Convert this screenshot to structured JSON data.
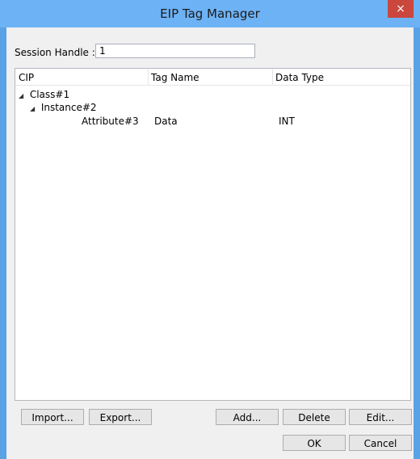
{
  "window": {
    "title": "EIP Tag Manager",
    "close_label": "×"
  },
  "session": {
    "label": "Session Handle :",
    "value": "1"
  },
  "list": {
    "columns": [
      "CIP",
      "Tag Name",
      "Data Type"
    ],
    "tree": {
      "class_label": "Class#1",
      "instance_label": "Instance#2",
      "attribute_label": "Attribute#3",
      "tag_name": "Data",
      "data_type": "INT",
      "expand_glyph": "◢"
    }
  },
  "buttons": {
    "import": "Import...",
    "export": "Export...",
    "add": "Add...",
    "delete": "Delete",
    "edit": "Edit...",
    "ok": "OK",
    "cancel": "Cancel"
  }
}
